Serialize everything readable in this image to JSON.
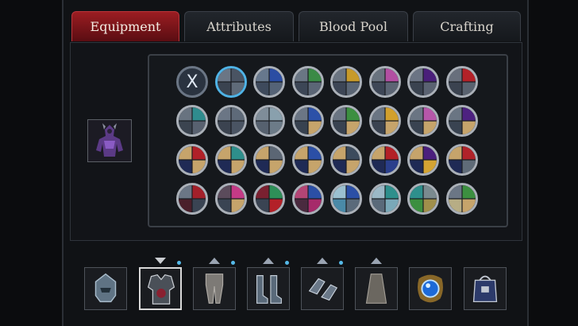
{
  "tabs": [
    {
      "label": "Equipment",
      "active": true
    },
    {
      "label": "Attributes",
      "active": false
    },
    {
      "label": "Blood Pool",
      "active": false
    },
    {
      "label": "Crafting",
      "active": false
    }
  ],
  "swatches": {
    "remove_label": "X",
    "rows": [
      [
        "remove",
        [
          "#4a5463",
          "#5f6b79",
          "#3a4350",
          "#6b7685"
        ],
        [
          "#2b4da3",
          "#556377",
          "#3e4a5c",
          "#67788d"
        ],
        [
          "#3a8a46",
          "#5b6676",
          "#3c4656",
          "#6a7684"
        ],
        [
          "#c79a2a",
          "#5a6574",
          "#3d4656",
          "#6b7582"
        ],
        [
          "#b24fa2",
          "#5c6574",
          "#3e4757",
          "#69737f"
        ],
        [
          "#4a1f7a",
          "#5a6271",
          "#3a4350",
          "#6b7484"
        ],
        [
          "#b32128",
          "#59626f",
          "#3b4350",
          "#686f7c"
        ]
      ],
      [
        [
          "#2f8c8e",
          "#586170",
          "#3b4450",
          "#687380"
        ],
        [
          "#5e6a79",
          "#4a5463",
          "#3b4350",
          "#6b7685"
        ],
        [
          "#89a0ad",
          "#6c7b88",
          "#56616f",
          "#7f8d99"
        ],
        [
          "#2c51a8",
          "#c6a46b",
          "#384250",
          "#6b7685"
        ],
        [
          "#3c8f40",
          "#c6a46b",
          "#394351",
          "#6a7583"
        ],
        [
          "#d2a02d",
          "#c6a46b",
          "#3a4351",
          "#6a7583"
        ],
        [
          "#b657a9",
          "#c6a46b",
          "#394351",
          "#6a7583"
        ],
        [
          "#4d2180",
          "#c6a46b",
          "#394351",
          "#6a7583"
        ]
      ],
      [
        [
          "#b02028",
          "#c6a46b",
          "#1f2a55",
          "#c6a46b"
        ],
        [
          "#2e8f8c",
          "#c6a46b",
          "#1f2a55",
          "#c6a46b"
        ],
        [
          "#5b6674",
          "#c6a46b",
          "#1f2a55",
          "#c6a46b"
        ],
        [
          "#2b4fa6",
          "#c6a46b",
          "#1f2a55",
          "#c6a46b"
        ],
        [
          "#3c4b5d",
          "#c6a46b",
          "#1f2a55",
          "#c6a46b"
        ],
        [
          "#b32027",
          "#2a3f8c",
          "#1f2a55",
          "#c6a46b"
        ],
        [
          "#4b1f7d",
          "#d4a433",
          "#1f2a55",
          "#c6a46b"
        ],
        [
          "#b02229",
          "#5f6b78",
          "#1f2a55",
          "#c6a46b"
        ]
      ],
      [
        [
          "#a3202a",
          "#3a4453",
          "#4a1f2a",
          "#6b7685"
        ],
        [
          "#c43a86",
          "#c6a46b",
          "#3a4453",
          "#5b4b5b"
        ],
        [
          "#2e8f58",
          "#b32128",
          "#3a4453",
          "#7a2030"
        ],
        [
          "#2b4fa6",
          "#a62a6a",
          "#4a2a3f",
          "#b34575"
        ],
        [
          "#2b4fa6",
          "#5a6a7a",
          "#4a8aa8",
          "#9bc0d0"
        ],
        [
          "#2e8f8c",
          "#7aa8b8",
          "#5a6a7a",
          "#9bb8c6"
        ],
        [
          "#7a8a8f",
          "#a08f4b",
          "#3c8f40",
          "#2e8f8c"
        ],
        [
          "#3c8f40",
          "#c6a46b",
          "#b7ad85",
          "#6b7685"
        ]
      ]
    ]
  },
  "equipment_slots": [
    {
      "name": "helmet-slot",
      "icon": "helmet-icon",
      "arrow": false,
      "dot": false,
      "selected": false
    },
    {
      "name": "chest-slot",
      "icon": "chest-armor-icon",
      "arrow": "down",
      "dot": true,
      "selected": true
    },
    {
      "name": "legs-slot",
      "icon": "legs-armor-icon",
      "arrow": "up",
      "dot": true,
      "selected": false
    },
    {
      "name": "boots-slot",
      "icon": "boots-icon",
      "arrow": "up",
      "dot": true,
      "selected": false
    },
    {
      "name": "gloves-slot",
      "icon": "gloves-icon",
      "arrow": "up",
      "dot": true,
      "selected": false
    },
    {
      "name": "cloak-slot",
      "icon": "cloak-icon",
      "arrow": "up",
      "dot": false,
      "selected": false
    },
    {
      "name": "necklace-slot",
      "icon": "amulet-icon",
      "arrow": false,
      "dot": false,
      "selected": false
    },
    {
      "name": "bag-slot",
      "icon": "bag-icon",
      "arrow": false,
      "dot": false,
      "selected": false
    }
  ],
  "colors": {
    "active_tab": "#9b1d22",
    "selected_ring": "#4fb3e6",
    "upgrade_dot": "#55b9e8"
  }
}
